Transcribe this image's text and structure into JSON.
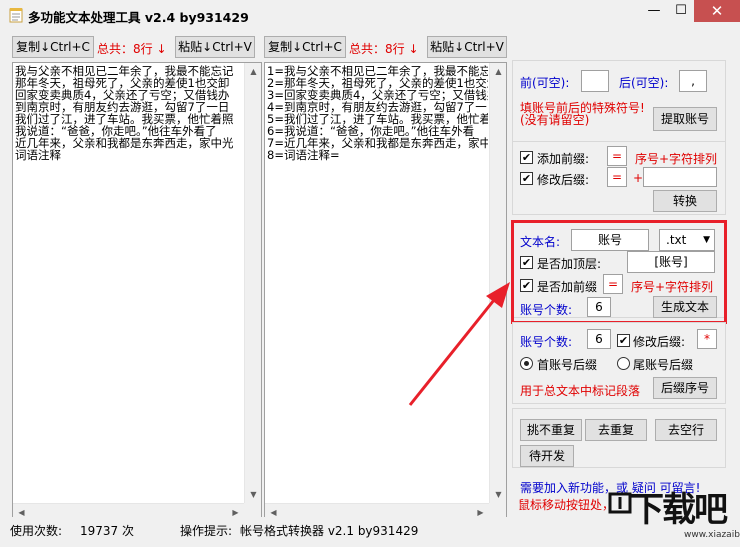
{
  "window": {
    "title": "多功能文本处理工具 v2.4 by931429",
    "minimize_symbol": "—",
    "maximize_symbol": "☐",
    "close_symbol": "✕"
  },
  "left_toolbar": {
    "copy_label": "复制↓Ctrl+C",
    "total_label": "总共：8行 ↓",
    "paste_label": "粘贴↓Ctrl+V"
  },
  "right_toolbar": {
    "copy_label": "复制↓Ctrl+C",
    "total_label": "总共：8行 ↓",
    "paste_label": "粘贴↓Ctrl+V"
  },
  "left_text": {
    "lines": [
      "我与父亲不相见已二年余了，我最不能忘记",
      "那年冬天，祖母死了，父亲的差使1也交卸",
      "回家变卖典质4，父亲还了亏空；又借钱办",
      "到南京时，有朋友约去游逛，勾留7了一日",
      "我们过了江，进了车站。我买票，他忙着照",
      "我说道：“爸爸，你走吧。”他往车外看了",
      "近几年来，父亲和我都是东奔西走，家中光",
      "词语注释"
    ]
  },
  "right_text": {
    "lines": [
      "1=我与父亲不相见已二年余了，我最不能忘",
      "2=那年冬天，祖母死了，父亲的差使1也交卸",
      "3=回家变卖典质4，父亲还了亏空；又借钱办",
      "4=到南京时，有朋友约去游逛，勾留7了一",
      "5=我们过了江，进了车站。我买票，他忙着照",
      "6=我说道：“爸爸，你走吧。”他往车外看",
      "7=近几年来，父亲和我都是东奔西走，家中光",
      "8=词语注释="
    ]
  },
  "account_panel": {
    "prefix_label": "前(可空):",
    "prefix_value": "",
    "suffix_label": "后(可空):",
    "suffix_value": ",",
    "hint_line1": "填账号前后的特殊符号!",
    "hint_line2": "(没有请留空)",
    "extract_button": "提取账号"
  },
  "modify_panel": {
    "add_prefix_label": "添加前缀:",
    "add_prefix_value": "=",
    "add_prefix_hint": "序号+字符排列",
    "modify_suffix_label": "修改后缀:",
    "modify_suffix_value": "=",
    "plus_sign": "+",
    "modify_suffix_extra": "",
    "convert_button": "转换"
  },
  "generate_panel": {
    "filename_label": "文本名:",
    "filename_value": "账号",
    "extension_value": ".txt",
    "add_header_label": "是否加顶层:",
    "header_value": "[账号]",
    "add_prefix_label": "是否加前缀",
    "prefix_value": "=",
    "prefix_hint": "序号+字符排列",
    "count_label": "账号个数:",
    "count_value": "6",
    "generate_button": "生成文本"
  },
  "suffix_panel": {
    "count_label": "账号个数:",
    "count_value": "6",
    "modify_suffix_label": "修改后缀:",
    "modify_suffix_value": "*",
    "radio_first_label": "首账号后缀",
    "radio_last_label": "尾账号后缀",
    "mark_hint": "用于总文本中标记段落",
    "suffix_seq_button": "后缀序号"
  },
  "tools_panel": {
    "pick_dup_button": "挑不重复",
    "remove_dup_button": "去重复",
    "remove_blank_button": "去空行",
    "pending_button": "待开发"
  },
  "footer_hint": {
    "line1": "需要加入新功能，或 疑问 可留言!",
    "line2": "鼠标移动按钮处，"
  },
  "status_bar": {
    "usage_label": "使用次数:",
    "usage_value": "19737 次",
    "tip_label": "操作提示:",
    "tip_value": "帐号格式转换器 v2.1 by931429"
  },
  "watermark": {
    "text": "下载吧",
    "url": "www.xiazaiba.com"
  },
  "colors": {
    "accent_red": "#e00000",
    "accent_blue": "#0000cc",
    "highlight_border": "#e8202a",
    "arrow": "#e8202a"
  }
}
